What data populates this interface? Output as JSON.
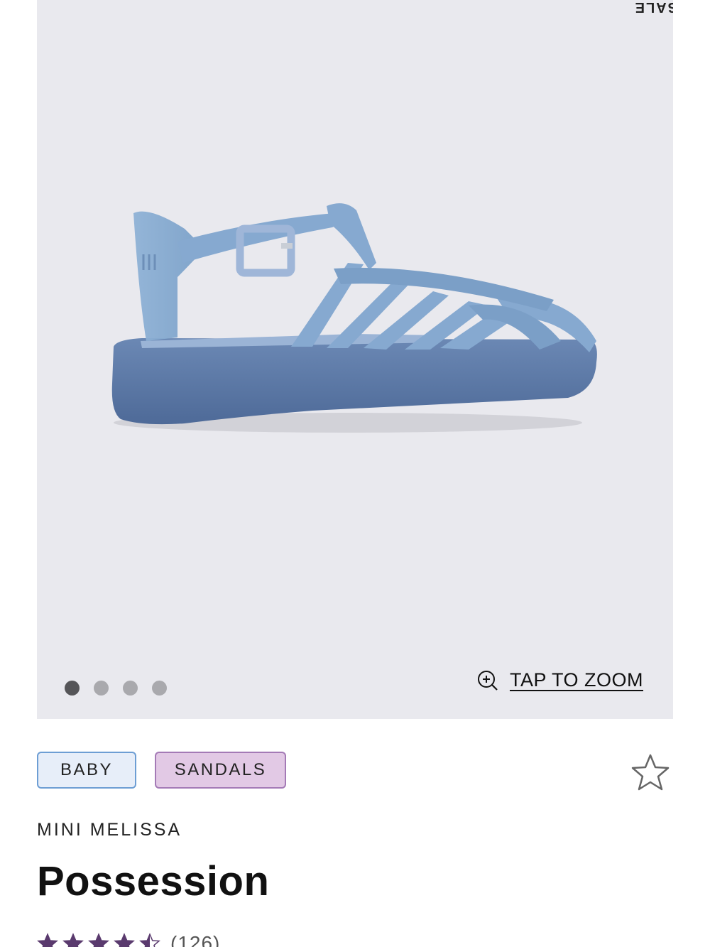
{
  "gallery": {
    "badge": "SALE",
    "image_alt": "Possession baby sandal, blue glitter",
    "dots": [
      {
        "active": true
      },
      {
        "active": false
      },
      {
        "active": false
      },
      {
        "active": false
      }
    ],
    "zoom_label": "TAP TO ZOOM"
  },
  "tags": {
    "baby": "BABY",
    "sandals": "SANDALS"
  },
  "product": {
    "brand": "MINI MELISSA",
    "title": "Possession",
    "rating_value": 4.5,
    "review_count": "(126)"
  },
  "colors": {
    "gallery_bg": "#e9e9ee",
    "tag_baby_border": "#6d9ed4",
    "tag_sandals_border": "#a47ab6",
    "star_color": "#5a3a6e"
  }
}
